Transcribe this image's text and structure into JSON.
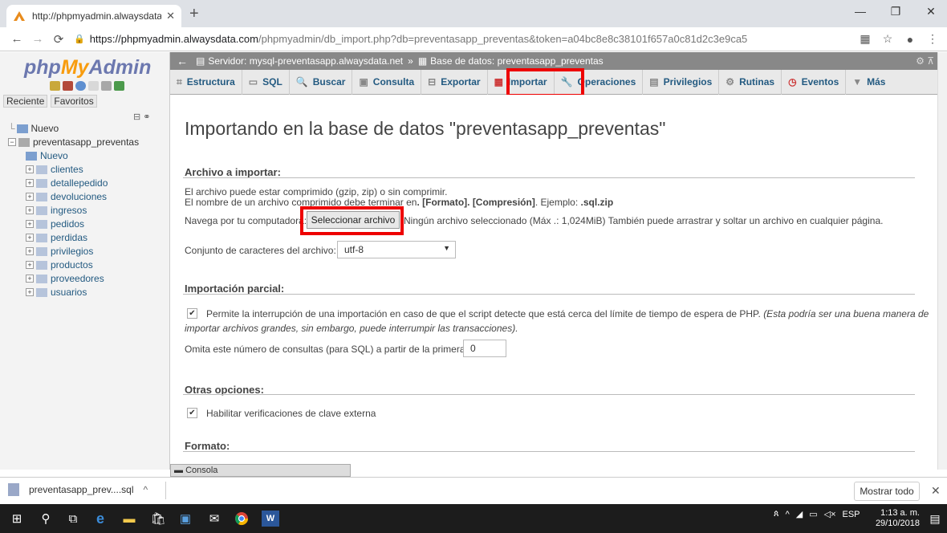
{
  "browser": {
    "tab_title": "http://phpmyadmin.alwaysdata.c",
    "url_domain": "https://phpmyadmin.alwaysdata.com",
    "url_path": "/phpmyadmin/db_import.php?db=preventasapp_preventas&token=a04bc8e8c38101f657a0c81d2c3e9ca5"
  },
  "logo": {
    "php": "php",
    "my": "My",
    "admin": "Admin"
  },
  "nav_tabs": [
    "Reciente",
    "Favoritos"
  ],
  "tree": {
    "new_top": "Nuevo",
    "db": "preventasapp_preventas",
    "new_inner": "Nuevo",
    "tables": [
      "clientes",
      "detallepedido",
      "devoluciones",
      "ingresos",
      "pedidos",
      "perdidas",
      "privilegios",
      "productos",
      "proveedores",
      "usuarios"
    ]
  },
  "breadcrumb": {
    "server": "Servidor: mysql-preventasapp.alwaysdata.net",
    "sep": "»",
    "db": "Base de datos: preventasapp_preventas"
  },
  "tabs": [
    "Estructura",
    "SQL",
    "Buscar",
    "Consulta",
    "Exportar",
    "Importar",
    "Operaciones",
    "Privilegios",
    "Rutinas",
    "Eventos",
    "Más"
  ],
  "page_title": "Importando en la base de datos \"preventasapp_preventas\"",
  "file_section": {
    "heading": "Archivo a importar:",
    "line1": "El archivo puede estar comprimido (gzip, zip) o sin comprimir.",
    "line2_a": "El nombre de un archivo comprimido debe terminar en",
    "line2_b": ". [Formato]. [Compresión]",
    "line2_c": ". Ejemplo:",
    "line2_d": ".sql.zip",
    "browse_label": "Navega por tu computadora:",
    "browse_button": "Seleccionar archivo",
    "no_file": "Ningún archivo seleccionado",
    "max": "(Máx .: 1,024MiB) También puede arrastrar y soltar un archivo en cualquier página.",
    "charset_label": "Conjunto de caracteres del archivo:",
    "charset_value": "utf-8"
  },
  "partial_section": {
    "heading": "Importación parcial:",
    "allow_interrupt": "Permite la interrupción de una importación en caso de que el script detecte que está cerca del límite de tiempo de espera de PHP.",
    "allow_interrupt_note_1": "(Esta podría ser una buena manera de",
    "allow_interrupt_note_2": "importar archivos grandes, sin embargo, puede interrumpir las transacciones).",
    "skip_label": "Omita este número de consultas (para SQL) a partir de la primera:",
    "skip_value": "0"
  },
  "other_section": {
    "heading": "Otras opciones:",
    "fk_checks": "Habilitar verificaciones de clave externa"
  },
  "format_section": {
    "heading": "Formato:"
  },
  "console_label": "Consola",
  "download": {
    "file": "preventasapp_prev....sql",
    "show_all": "Mostrar todo"
  },
  "taskbar": {
    "lang": "ESP",
    "time": "1:13 a. m.",
    "date": "29/10/2018"
  },
  "colors": {
    "highlight": "#e00000",
    "link": "#235a81"
  }
}
